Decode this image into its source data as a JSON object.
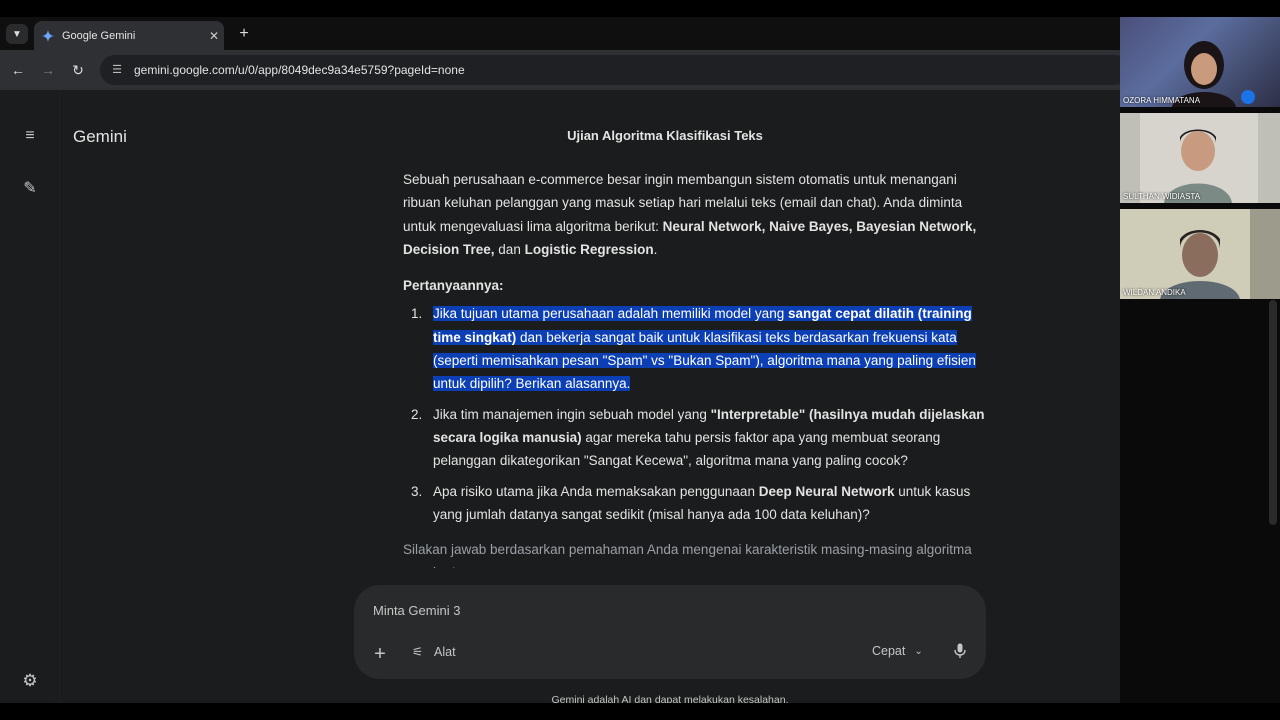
{
  "browser": {
    "tab_title": "Google Gemini",
    "tab_close": "✕",
    "new_tab": "+",
    "url": "gemini.google.com/u/0/app/8049dec9a34e5759?pageId=none"
  },
  "app": {
    "brand": "Gemini",
    "chat_title": "Ujian Algoritma Klasifikasi Teks"
  },
  "content": {
    "intro": [
      {
        "text": "Sebuah perusahaan e-commerce besar ingin membangun sistem otomatis untuk menangani ribuan keluhan pelanggan yang masuk setiap hari melalui teks (email dan chat). Anda diminta untuk mengevaluasi lima algoritma berikut: "
      },
      {
        "text": "Neural Network, Naive Bayes, Bayesian Network, Decision Tree,",
        "bold": true
      },
      {
        "text": " dan "
      },
      {
        "text": "Logistic Regression",
        "bold": true
      },
      {
        "text": "."
      }
    ],
    "heading": "Pertanyaannya:",
    "questions": [
      {
        "num": "1.",
        "highlight": true,
        "parts": [
          {
            "text": "Jika tujuan utama perusahaan adalah memiliki model yang "
          },
          {
            "text": "sangat cepat dilatih (training time singkat)",
            "bold": true
          },
          {
            "text": " dan bekerja sangat baik untuk klasifikasi teks berdasarkan frekuensi kata (seperti memisahkan pesan \"Spam\" vs \"Bukan Spam\"), algoritma mana yang paling efisien untuk dipilih? Berikan alasannya."
          }
        ]
      },
      {
        "num": "2.",
        "highlight": false,
        "parts": [
          {
            "text": "Jika tim manajemen ingin sebuah model yang "
          },
          {
            "text": "\"Interpretable\" (hasilnya mudah dijelaskan secara logika manusia)",
            "bold": true
          },
          {
            "text": " agar mereka tahu persis faktor apa yang membuat seorang pelanggan dikategorikan \"Sangat Kecewa\", algoritma mana yang paling cocok?"
          }
        ]
      },
      {
        "num": "3.",
        "highlight": false,
        "parts": [
          {
            "text": "Apa risiko utama jika Anda memaksakan penggunaan "
          },
          {
            "text": "Deep Neural Network",
            "bold": true
          },
          {
            "text": " untuk kasus yang jumlah datanya sangat sedikit (misal hanya ada 100 data keluhan)?"
          }
        ]
      }
    ],
    "closing": "Silakan jawab berdasarkan pemahaman Anda mengenai karakteristik masing-masing algoritma tersebut!"
  },
  "composer": {
    "placeholder": "Minta Gemini 3",
    "plus": "+",
    "tools_label": "Alat",
    "mode_label": "Cepat"
  },
  "disclaimer": "Gemini adalah AI dan dapat melakukan kesalahan.",
  "participants": [
    {
      "name": "OZORA HIMMATANA"
    },
    {
      "name": "SULTHAN WIDIASTA"
    },
    {
      "name": "WILDAN ANDIKA"
    }
  ],
  "colors": {
    "background": "#1b1c1d",
    "selection": "#0b3fb3",
    "composer": "#282a2c",
    "text": "#e3e3e3"
  },
  "icons": [
    "chevron-down-icon",
    "gemini-spark-icon",
    "close-icon",
    "plus-icon",
    "back-icon",
    "forward-icon",
    "reload-icon",
    "site-info-icon",
    "menu-icon",
    "new-chat-icon",
    "settings-icon",
    "tools-icon",
    "mic-icon"
  ]
}
